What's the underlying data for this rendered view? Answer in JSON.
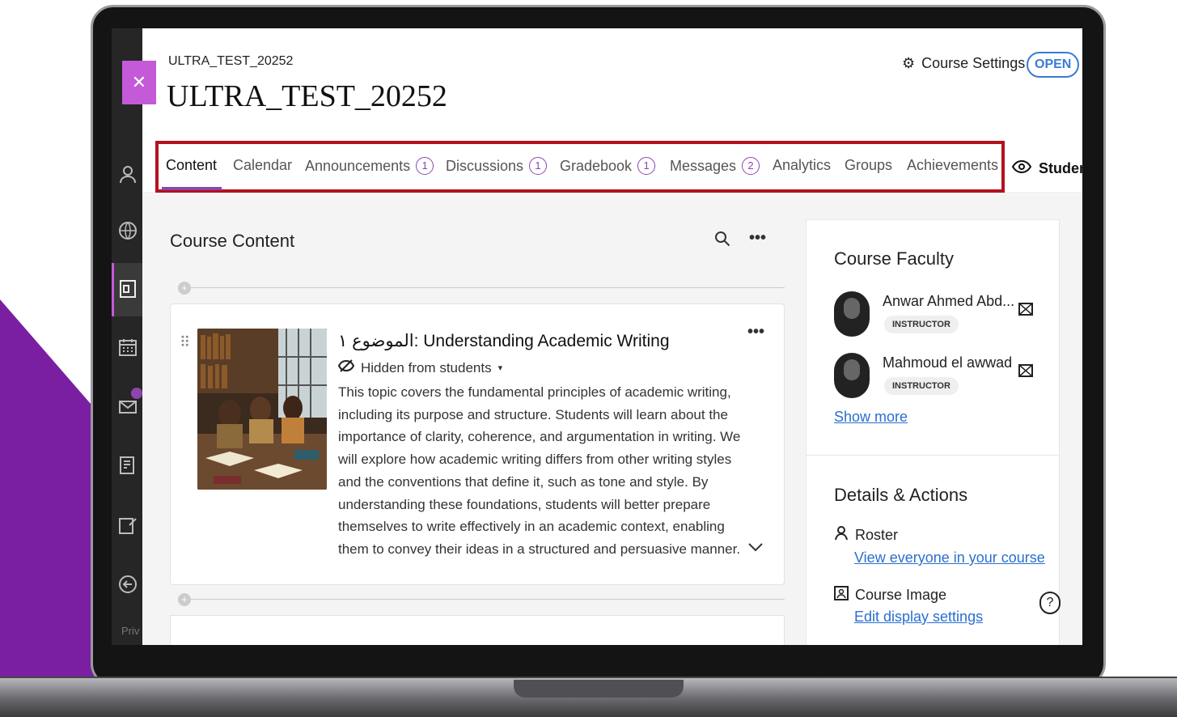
{
  "course": {
    "code": "ULTRA_TEST_20252",
    "title": "ULTRA_TEST_20252"
  },
  "header": {
    "settings_label": "Course Settings",
    "status": "OPEN"
  },
  "tabs": [
    {
      "label": "Content",
      "badge": null
    },
    {
      "label": "Calendar",
      "badge": null
    },
    {
      "label": "Announcements",
      "badge": "1"
    },
    {
      "label": "Discussions",
      "badge": "1"
    },
    {
      "label": "Gradebook",
      "badge": "1"
    },
    {
      "label": "Messages",
      "badge": "2"
    },
    {
      "label": "Analytics",
      "badge": null
    },
    {
      "label": "Groups",
      "badge": null
    },
    {
      "label": "Achievements",
      "badge": null
    }
  ],
  "student_view_label": "Student",
  "sidebar": {
    "privacy_label": "Priv"
  },
  "content": {
    "title": "Course Content",
    "item": {
      "title": "الموضوع ١: Understanding Academic Writing",
      "visibility": "Hidden from students",
      "description": "This topic covers the fundamental principles of academic writing, including its purpose and structure. Students will learn about the importance of clarity, coherence, and argumentation in writing. We will explore how academic writing differs from other writing styles and the conventions that define it, such as tone and style. By understanding these foundations, students will better prepare themselves to write effectively in an academic context, enabling them to convey their ideas in a structured and persuasive manner."
    }
  },
  "faculty": {
    "title": "Course Faculty",
    "members": [
      {
        "name": "Anwar Ahmed Abd...",
        "role": "INSTRUCTOR"
      },
      {
        "name": "Mahmoud el awwad",
        "role": "INSTRUCTOR"
      }
    ],
    "show_more": "Show more"
  },
  "details": {
    "title": "Details & Actions",
    "roster": {
      "label": "Roster",
      "link": "View everyone in your course"
    },
    "course_image": {
      "label": "Course Image",
      "link": "Edit display settings"
    }
  },
  "colors": {
    "accent": "#8e44ad",
    "link": "#2a6fcf",
    "highlight_box": "#b3121e",
    "background_shape": "#7b1fa2"
  }
}
